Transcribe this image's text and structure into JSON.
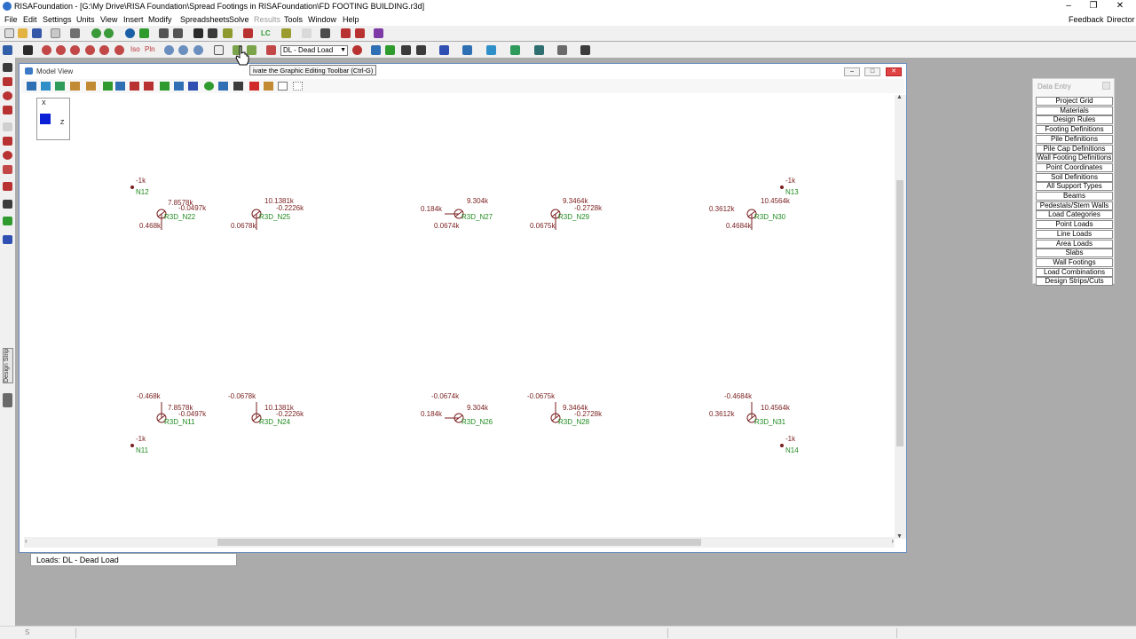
{
  "window": {
    "title": "RISAFoundation - [G:\\My Drive\\RISA Foundation\\Spread Footings in RISAFoundation\\FD FOOTING BUILDING.r3d]",
    "minimize": "–",
    "restore": "❐",
    "close": "✕"
  },
  "menu": {
    "items": [
      "File",
      "Edit",
      "Settings",
      "Units",
      "View",
      "Insert",
      "Modify",
      "Spreadsheets",
      "Solve",
      "Results",
      "Tools",
      "Window",
      "Help"
    ],
    "feedback": "Feedback",
    "user": "Director"
  },
  "toolbar": {
    "lc_label": "LC",
    "iso_label": "Iso",
    "pln_label": "Pln",
    "load_select_value": "DL - Dead Load"
  },
  "tooltip": "ivate the Graphic Editing Toolbar (Ctrl-G)",
  "left_panel": {
    "design_strip_tab": "Design Strip"
  },
  "model_view": {
    "title": "Model View",
    "axis_x": "X",
    "axis_z": "Z",
    "loads_label": "Loads: DL - Dead Load",
    "points": [
      {
        "node": "N12",
        "load": "-1k"
      },
      {
        "node": "N13",
        "load": "-1k"
      },
      {
        "node": "N11",
        "load": "-1k"
      },
      {
        "node": "N14",
        "load": "-1k"
      }
    ],
    "pedestals": [
      {
        "id": "R3D_N22",
        "labels": [
          "7.8578k",
          "-0.0497k",
          "0.468k"
        ]
      },
      {
        "id": "R3D_N25",
        "labels": [
          "10.1381k",
          "-0.2226k",
          "0.0678k"
        ]
      },
      {
        "id": "R3D_N27",
        "labels": [
          "9.304k",
          "0.184k",
          "0.0674k"
        ]
      },
      {
        "id": "R3D_N29",
        "labels": [
          "9.3464k",
          "-0.2728k",
          "0.0675k"
        ]
      },
      {
        "id": "R3D_N30",
        "labels": [
          "10.4564k",
          "0.3612k",
          "0.4684k"
        ]
      },
      {
        "id": "R3D_N11",
        "labels": [
          "-0.468k",
          "7.8578k",
          "-0.0497k"
        ]
      },
      {
        "id": "R3D_N24",
        "labels": [
          "-0.0678k",
          "10.1381k",
          "-0.2226k"
        ]
      },
      {
        "id": "R3D_N26",
        "labels": [
          "-0.0674k",
          "9.304k",
          "0.184k"
        ]
      },
      {
        "id": "R3D_N28",
        "labels": [
          "-0.0675k",
          "9.3464k",
          "-0.2728k"
        ]
      },
      {
        "id": "R3D_N31",
        "labels": [
          "-0.4684k",
          "10.4564k",
          "0.3612k"
        ]
      }
    ]
  },
  "data_entry": {
    "title": "Data Entry",
    "items": [
      "Project Grid",
      "Materials",
      "Design Rules",
      "Footing Definitions",
      "Pile Definitions",
      "Pile Cap Definitions",
      "Wall Footing Definitions",
      "Point Coordinates",
      "Soil Definitions",
      "All Support Types",
      "Beams",
      "Pedestals/Stem Walls",
      "Load Categories",
      "Point Loads",
      "Line Loads",
      "Area Loads",
      "Slabs",
      "Wall Footings",
      "Load Combinations",
      "Design Strips/Cuts"
    ]
  },
  "status": {
    "left": "S"
  },
  "colors": {
    "node_green": "#1f8a1f",
    "load_red": "#7a1f1f",
    "axis_blue": "#0a1fd6",
    "workspace": "#ababab"
  }
}
